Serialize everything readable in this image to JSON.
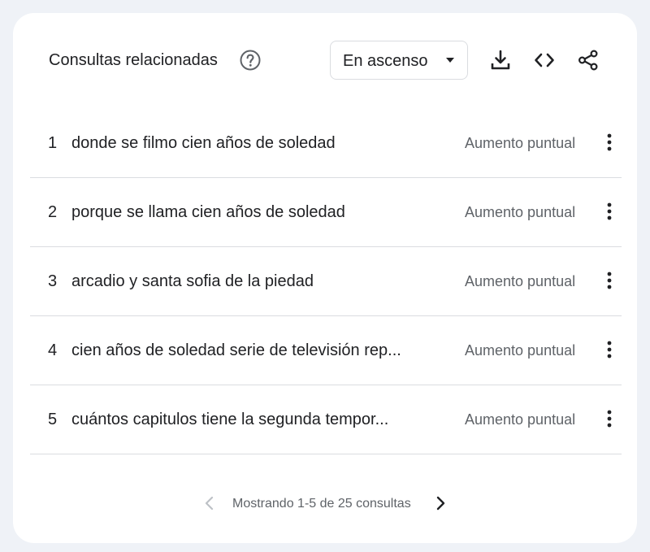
{
  "header": {
    "title": "Consultas relacionadas",
    "help_icon": "help-circle-icon",
    "dropdown": {
      "selected": "En ascenso",
      "icon": "caret-down-icon"
    },
    "toolbar": {
      "download_icon": "download-icon",
      "embed_icon": "code-embed-icon",
      "share_icon": "share-icon"
    }
  },
  "rows": [
    {
      "rank": "1",
      "query": "donde se filmo cien años de soledad",
      "value": "Aumento puntual"
    },
    {
      "rank": "2",
      "query": "porque se llama cien años de soledad",
      "value": "Aumento puntual"
    },
    {
      "rank": "3",
      "query": "arcadio y santa sofia de la piedad",
      "value": "Aumento puntual"
    },
    {
      "rank": "4",
      "query": "cien años de soledad serie de televisión rep...",
      "value": "Aumento puntual"
    },
    {
      "rank": "5",
      "query": "cuántos capitulos tiene la segunda tempor...",
      "value": "Aumento puntual"
    }
  ],
  "pagination": {
    "text": "Mostrando 1-5 de 25 consultas",
    "prev_icon": "chevron-left-icon",
    "next_icon": "chevron-right-icon",
    "prev_disabled": true
  },
  "colors": {
    "background": "#eff2f7",
    "card": "#ffffff",
    "text_primary": "#202124",
    "text_secondary": "#5f6368",
    "divider": "#dadce0",
    "disabled": "#bdc1c6"
  }
}
